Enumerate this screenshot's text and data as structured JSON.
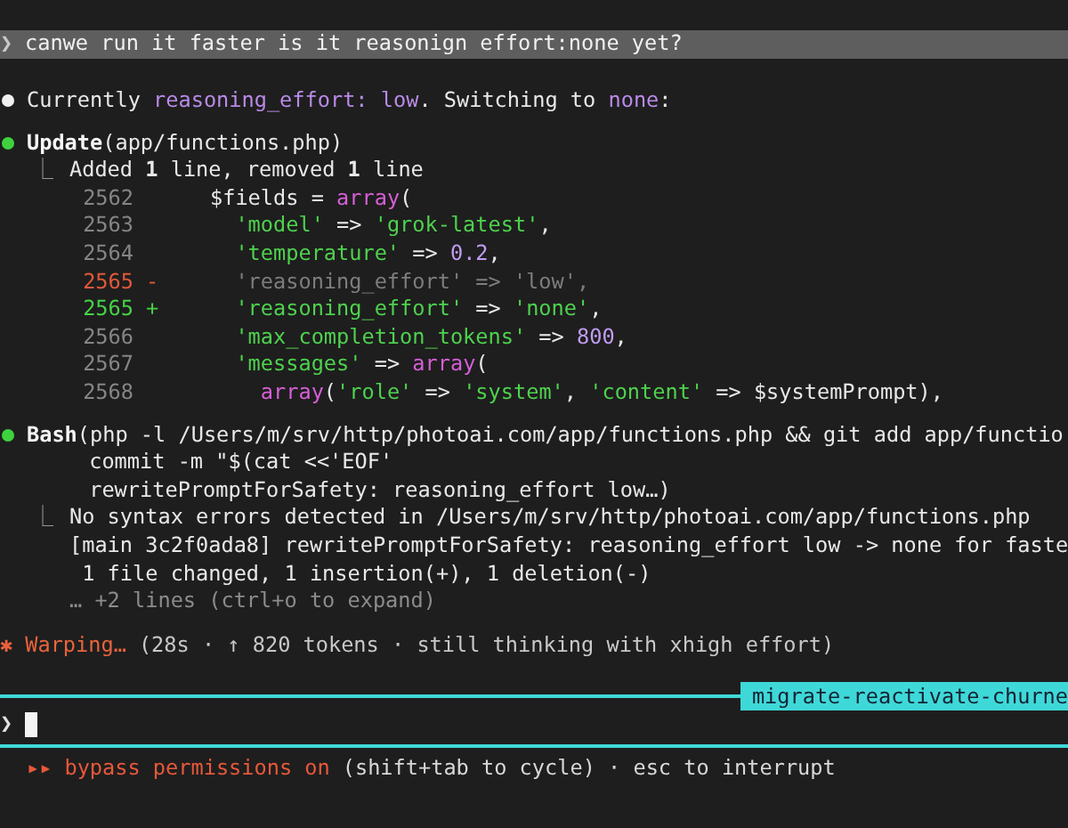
{
  "prompt": {
    "glyph": "❯",
    "text": "canwe run it faster is it reasonign effort:none yet?"
  },
  "messages": [
    {
      "kind": "text",
      "segments": [
        {
          "text": "Currently ",
          "highlight": false
        },
        {
          "text": "reasoning_effort: low",
          "highlight": true
        },
        {
          "text": ". Switching to ",
          "highlight": false
        },
        {
          "text": "none",
          "highlight": true
        },
        {
          "text": ":",
          "highlight": false
        }
      ]
    },
    {
      "kind": "tool",
      "name": "Update",
      "args": [
        "(app/functions.php)"
      ],
      "result_glyph": "⎿",
      "results": [
        {
          "text": "Added **1** line, removed **1** line",
          "muted": false
        }
      ],
      "diff": [
        {
          "number": "2562",
          "kind": "context",
          "tokens": [
            {
              "text": "$fields = ",
              "kind": "plain"
            },
            {
              "text": "array",
              "kind": "keyword"
            },
            {
              "text": "(",
              "kind": "plain"
            }
          ]
        },
        {
          "number": "2563",
          "kind": "context",
          "tokens": [
            {
              "text": "  'model'",
              "kind": "string"
            },
            {
              "text": " => ",
              "kind": "plain"
            },
            {
              "text": "'grok-latest'",
              "kind": "string"
            },
            {
              "text": ",",
              "kind": "plain"
            }
          ]
        },
        {
          "number": "2564",
          "kind": "context",
          "tokens": [
            {
              "text": "  'temperature'",
              "kind": "string"
            },
            {
              "text": " => ",
              "kind": "plain"
            },
            {
              "text": "0.2",
              "kind": "number"
            },
            {
              "text": ",",
              "kind": "plain"
            }
          ]
        },
        {
          "number": "2565",
          "kind": "removed",
          "marker": "-",
          "tokens": [
            {
              "text": "  'reasoning_effort' => 'low',",
              "kind": "plain"
            }
          ]
        },
        {
          "number": "2565",
          "kind": "added",
          "marker": "+",
          "tokens": [
            {
              "text": "  'reasoning_effort'",
              "kind": "string"
            },
            {
              "text": " => ",
              "kind": "plain"
            },
            {
              "text": "'none'",
              "kind": "string"
            },
            {
              "text": ",",
              "kind": "plain"
            }
          ]
        },
        {
          "number": "2566",
          "kind": "context",
          "tokens": [
            {
              "text": "  'max_completion_tokens'",
              "kind": "string"
            },
            {
              "text": " => ",
              "kind": "plain"
            },
            {
              "text": "800",
              "kind": "number"
            },
            {
              "text": ",",
              "kind": "plain"
            }
          ]
        },
        {
          "number": "2567",
          "kind": "context",
          "tokens": [
            {
              "text": "  'messages'",
              "kind": "string"
            },
            {
              "text": " => ",
              "kind": "plain"
            },
            {
              "text": "array",
              "kind": "keyword"
            },
            {
              "text": "(",
              "kind": "plain"
            }
          ]
        },
        {
          "number": "2568",
          "kind": "context",
          "tokens": [
            {
              "text": "    array",
              "kind": "keyword"
            },
            {
              "text": "(",
              "kind": "plain"
            },
            {
              "text": "'role'",
              "kind": "string"
            },
            {
              "text": " => ",
              "kind": "plain"
            },
            {
              "text": "'system'",
              "kind": "string"
            },
            {
              "text": ", ",
              "kind": "plain"
            },
            {
              "text": "'content'",
              "kind": "string"
            },
            {
              "text": " => $systemPrompt),",
              "kind": "plain"
            }
          ]
        }
      ]
    },
    {
      "kind": "tool",
      "name": "Bash",
      "args": [
        "(php -l /Users/m/srv/http/photoai.com/app/functions.php && git add app/functio",
        " commit -m \"$(cat <<'EOF'",
        " rewritePromptForSafety: reasoning_effort low…)"
      ],
      "result_glyph": "⎿",
      "results": [
        {
          "text": "No syntax errors detected in /Users/m/srv/http/photoai.com/app/functions.php",
          "muted": false
        },
        {
          "text": "[main 3c2f0ada8] rewritePromptForSafety: reasoning_effort low -> none for faste",
          "muted": false
        },
        {
          "text": " 1 file changed, 1 insertion(+), 1 deletion(-)",
          "muted": false
        },
        {
          "text": "… +2 lines (ctrl+o to expand)",
          "muted": true
        }
      ]
    }
  ],
  "status": {
    "glyph": "✱",
    "verb": "Warping…",
    "detail": "(28s · ↑ 820 tokens · still thinking with xhigh effort)"
  },
  "input": {
    "glyph": "❯",
    "branch": "migrate-reactivate-churne"
  },
  "footer": {
    "glyph": "▸▸",
    "mode": "bypass permissions on",
    "hint": "(shift+tab to cycle) · esc to interrupt"
  }
}
